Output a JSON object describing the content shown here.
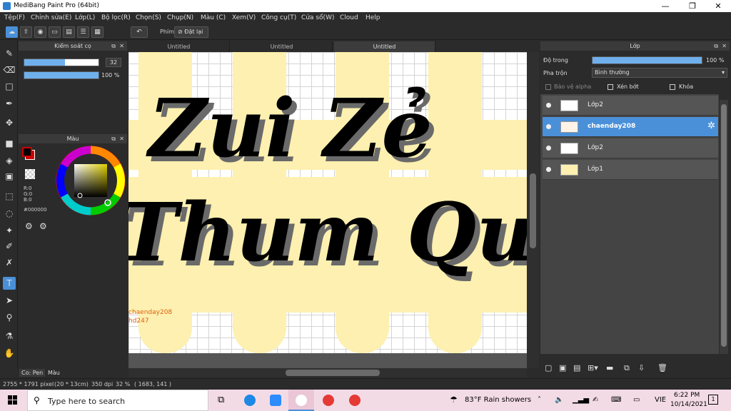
{
  "window": {
    "title": "MediBang Paint Pro (64bit)",
    "minimize": "—",
    "maximize": "❐",
    "close": "✕"
  },
  "menu": [
    "Tệp(F)",
    "Chỉnh sửa(E)",
    "Lớp(L)",
    "Bộ lọc(R)",
    "Chọn(S)",
    "Chụp(N)",
    "Màu (C)",
    "Xem(V)",
    "Công cụ(T)",
    "Cửa sổ(W)",
    "Cloud",
    "Help"
  ],
  "toolbar": {
    "shortcut_label": "Phím",
    "reset_label": "Đặt lại"
  },
  "brush_panel": {
    "title": "Kiểm soát cọ",
    "size_value": "32",
    "size_fill": 0.55,
    "opacity_value": "100 %",
    "opacity_fill": 1.0
  },
  "color_panel": {
    "title": "Màu",
    "r": "R:0",
    "g": "G:0",
    "b": "B:0",
    "hex": "#000000"
  },
  "left_tabs": {
    "pen": "Co: Pen",
    "color": "Màu"
  },
  "tabs": [
    "Untitled",
    "Untitled",
    "Untitled"
  ],
  "canvas": {
    "line1": "Zui Zẻ",
    "line2": "Thum Qua",
    "watermark1": "chaenday208",
    "watermark2": "hd247"
  },
  "layer_panel": {
    "title": "Lớp",
    "opacity_label": "Độ trong",
    "opacity_value": "100 %",
    "opacity_fill": 1.0,
    "blend_label": "Pha trộn",
    "blend_value": "Bình thường",
    "protect_alpha": "Bảo vệ alpha",
    "clipping": "Xén bớt",
    "lock": "Khóa",
    "layers": [
      {
        "name": "Lớp2"
      },
      {
        "name": "chaenday208"
      },
      {
        "name": "Lớp2"
      },
      {
        "name": "Lớp1"
      }
    ]
  },
  "status": {
    "size": "2755 * 1791 pixel",
    "cm": "(20 * 13cm)",
    "dpi": "350 dpi",
    "zoom": "32 %",
    "coords": "( 1683, 141 )"
  },
  "taskbar": {
    "search_placeholder": "Type here to search",
    "weather": "83°F  Rain showers",
    "lang": "VIE",
    "time": "6:22 PM",
    "date": "10/14/2021",
    "notif": "1"
  }
}
